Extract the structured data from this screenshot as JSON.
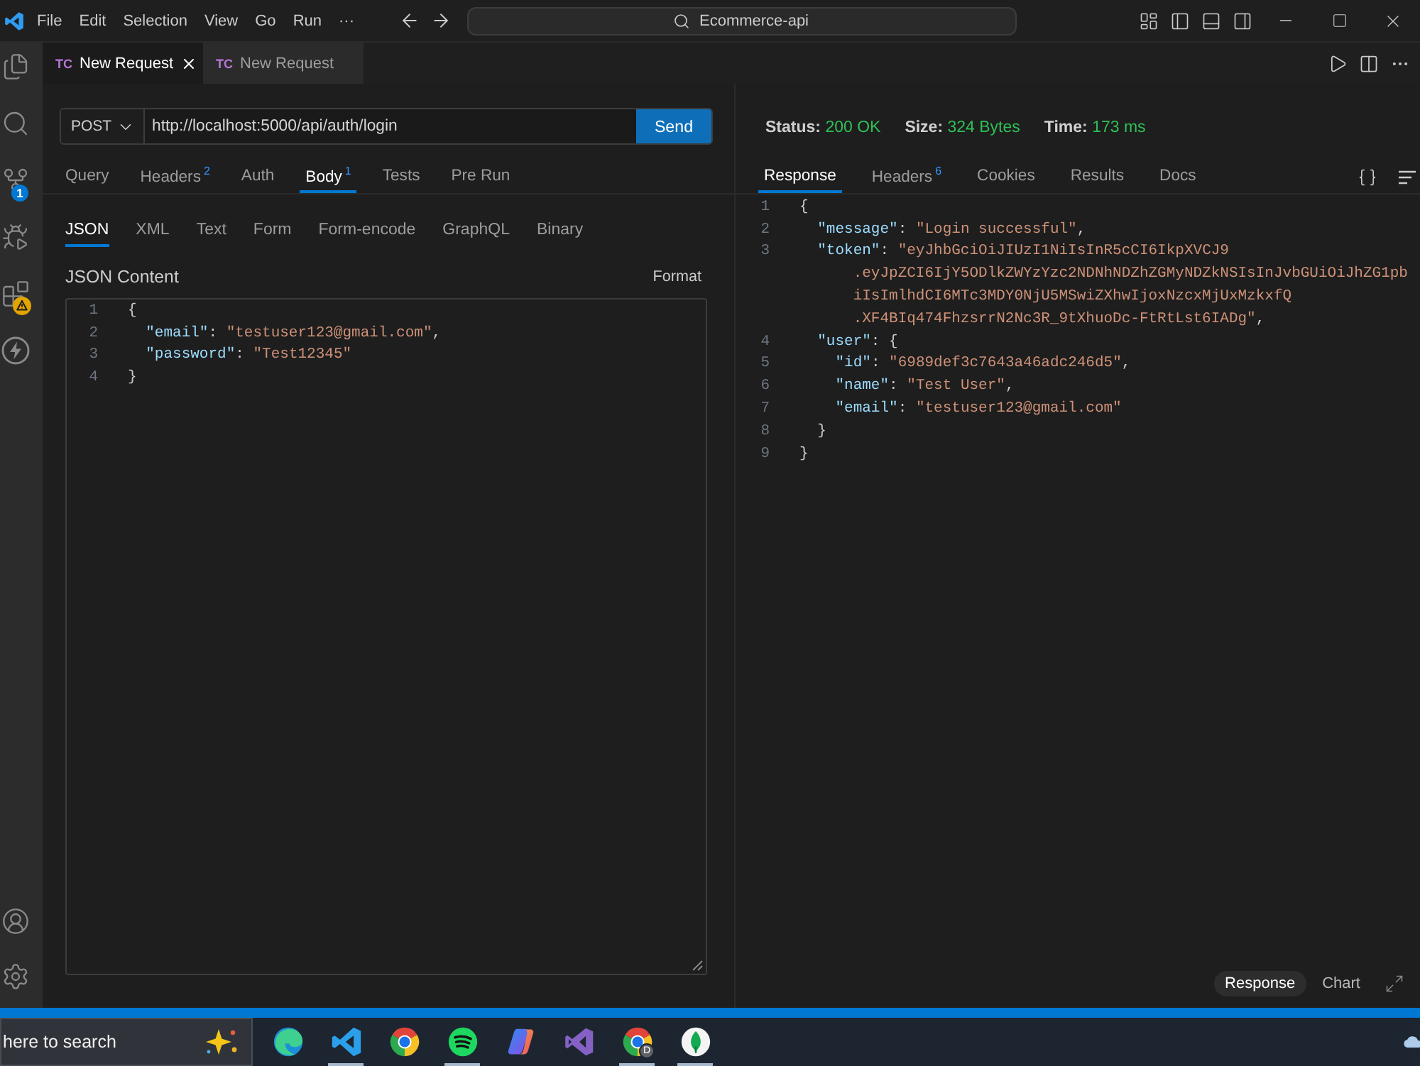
{
  "title_bar": {
    "menu": [
      "File",
      "Edit",
      "Selection",
      "View",
      "Go",
      "Run",
      "···"
    ],
    "command_center": "Ecommerce-api"
  },
  "activity_bar": {
    "source_control_badge": "1",
    "extensions_warning": true
  },
  "editor_tabs": [
    {
      "icon_text": "TC",
      "label": "New Request",
      "selected": true
    },
    {
      "icon_text": "TC",
      "label": "New Request",
      "selected": false
    }
  ],
  "request": {
    "method": "POST",
    "url": "http://localhost:5000/api/auth/login",
    "send_label": "Send",
    "tabs": [
      {
        "label": "Query",
        "selected": false
      },
      {
        "label": "Headers",
        "count": "2",
        "selected": false
      },
      {
        "label": "Auth",
        "selected": false
      },
      {
        "label": "Body",
        "count": "1",
        "selected": true
      },
      {
        "label": "Tests",
        "selected": false
      },
      {
        "label": "Pre Run",
        "selected": false
      }
    ],
    "body_types": [
      {
        "label": "JSON",
        "selected": true
      },
      {
        "label": "XML",
        "selected": false
      },
      {
        "label": "Text",
        "selected": false
      },
      {
        "label": "Form",
        "selected": false
      },
      {
        "label": "Form-encode",
        "selected": false
      },
      {
        "label": "GraphQL",
        "selected": false
      },
      {
        "label": "Binary",
        "selected": false
      }
    ],
    "content_label": "JSON Content",
    "format_label": "Format",
    "lines": [
      {
        "number": "1",
        "code": "{"
      },
      {
        "number": "2",
        "code": "  \"email\": \"testuser123@gmail.com\","
      },
      {
        "number": "3",
        "code": "  \"password\": \"Test12345\""
      },
      {
        "number": "4",
        "code": "}"
      }
    ]
  },
  "response": {
    "stats": [
      {
        "label": "Status:",
        "value": "200 OK"
      },
      {
        "label": "Size:",
        "value": "324 Bytes"
      },
      {
        "label": "Time:",
        "value": "173 ms"
      }
    ],
    "tabs": [
      {
        "label": "Response",
        "selected": true
      },
      {
        "label": "Headers",
        "count": "6",
        "selected": false
      },
      {
        "label": "Cookies",
        "selected": false
      },
      {
        "label": "Results",
        "selected": false
      },
      {
        "label": "Docs",
        "selected": false
      }
    ],
    "lines": [
      {
        "number": "1",
        "code": "{"
      },
      {
        "number": "2",
        "code": "  \"message\": \"Login successful\","
      },
      {
        "number": "3",
        "code": "  \"token\": \"eyJhbGciOiJIUzI1NiIsInR5cCI6IkpXVCJ9"
      },
      {
        "code": "      .eyJpZCI6IjY5ODlkZWYzYzc2NDNhNDZhZGMyNDZkNSIsInJvbGUiOiJhZG1pb"
      },
      {
        "code": "      iIsImlhdCI6MTc3MDY0NjU5MSwiZXhwIjoxNzcxMjUxMzkxfQ"
      },
      {
        "code": "      .XF4BIq474FhzsrrN2Nc3R_9tXhuoDc-FtRtLst6IADg\","
      },
      {
        "number": "4",
        "code": "  \"user\": {"
      },
      {
        "number": "5",
        "code": "    \"id\": \"6989def3c7643a46adc246d5\","
      },
      {
        "number": "6",
        "code": "    \"name\": \"Test User\","
      },
      {
        "number": "7",
        "code": "    \"email\": \"testuser123@gmail.com\""
      },
      {
        "number": "8",
        "code": "  }"
      },
      {
        "number": "9",
        "code": "}"
      }
    ],
    "views": [
      {
        "label": "Response",
        "selected": true
      },
      {
        "label": "Chart",
        "selected": false
      }
    ]
  },
  "taskbar": {
    "search": {
      "placeholder": "here to search"
    },
    "apps": [
      {
        "kind": "swirl",
        "running": false
      },
      {
        "kind": "ribbon",
        "running": true
      },
      {
        "kind": "tricolor",
        "running": false
      },
      {
        "kind": "arcs",
        "running": true
      },
      {
        "kind": "petal",
        "running": false
      },
      {
        "kind": "infinity",
        "running": false
      },
      {
        "kind": "tricolor",
        "badge": "D",
        "running": true
      },
      {
        "kind": "leaf",
        "running": true
      }
    ]
  }
}
